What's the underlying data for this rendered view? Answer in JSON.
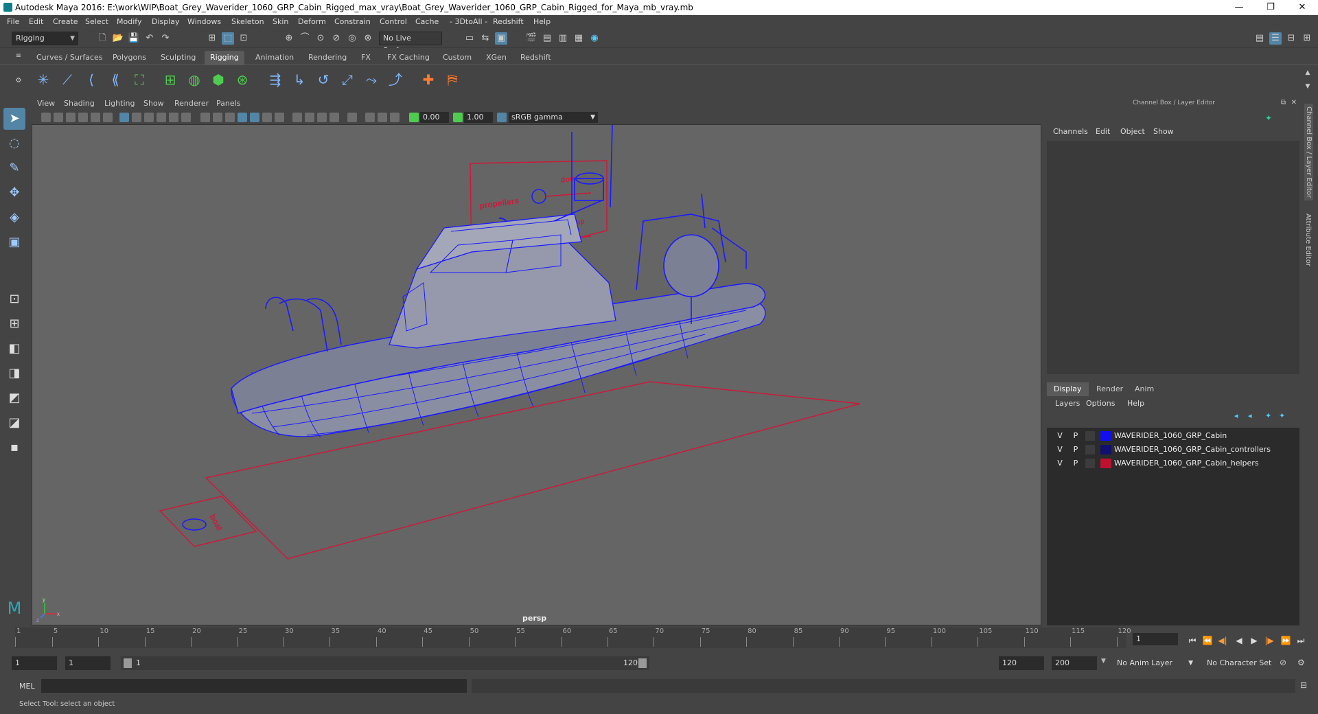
{
  "window": {
    "title": "Autodesk Maya 2016: E:\\work\\WIP\\Boat_Grey_Waverider_1060_GRP_Cabin_Rigged_max_vray\\Boat_Grey_Waverider_1060_GRP_Cabin_Rigged_for_Maya_mb_vray.mb",
    "minimize": "—",
    "restore": "❐",
    "close": "✕"
  },
  "menubar": [
    "File",
    "Edit",
    "Create",
    "Select",
    "Modify",
    "Display",
    "Windows",
    "Skeleton",
    "Skin",
    "Deform",
    "Constrain",
    "Control",
    "Cache",
    "- 3DtoAll -",
    "Redshift",
    "Help"
  ],
  "statusline": {
    "menuset": "Rigging",
    "live_surface": "No Live Surface"
  },
  "shelf_tabs": [
    "Curves / Surfaces",
    "Polygons",
    "Sculpting",
    "Rigging",
    "Animation",
    "Rendering",
    "FX",
    "FX Caching",
    "Custom",
    "XGen",
    "Redshift"
  ],
  "shelf_active": "Rigging",
  "panel_menu": [
    "View",
    "Shading",
    "Lighting",
    "Show",
    "Renderer",
    "Panels"
  ],
  "viewport_toolbar": {
    "exposure": "0.00",
    "gamma": "1.00",
    "color_space": "sRGB gamma"
  },
  "viewport": {
    "camera": "persp",
    "labels": {
      "propellers": "propellers",
      "door": "door",
      "engine_up": "engine up",
      "hull_label": "boat",
      "axis_y": "y",
      "axis_x": "x",
      "axis_z": "z"
    },
    "colors": {
      "wire": "#1a1aff",
      "controller": "#cc1a3a",
      "background": "#656565"
    }
  },
  "channel_box": {
    "title": "Channel Box / Layer Editor",
    "menu": [
      "Channels",
      "Edit",
      "Object",
      "Show"
    ]
  },
  "layer_editor": {
    "tabs": [
      "Display",
      "Render",
      "Anim"
    ],
    "active_tab": "Display",
    "menu": [
      "Layers",
      "Options",
      "Help"
    ],
    "layers": [
      {
        "v": "V",
        "p": "P",
        "name": "WAVERIDER_1060_GRP_Cabin",
        "color": "#1010ee"
      },
      {
        "v": "V",
        "p": "P",
        "name": "WAVERIDER_1060_GRP_Cabin_controllers",
        "color": "#101070"
      },
      {
        "v": "V",
        "p": "P",
        "name": "WAVERIDER_1060_GRP_Cabin_helpers",
        "color": "#c01030"
      }
    ]
  },
  "side_tabs": [
    "Channel Box / Layer Editor",
    "Attribute Editor"
  ],
  "time_slider": {
    "ticks": [
      1,
      5,
      10,
      15,
      20,
      25,
      30,
      35,
      40,
      45,
      50,
      55,
      60,
      65,
      70,
      75,
      80,
      85,
      90,
      95,
      100,
      105,
      110,
      115,
      120
    ],
    "current_frame": "1"
  },
  "range_slider": {
    "start": "1",
    "playback_start": "1",
    "range_start": "1",
    "range_end": "120",
    "playback_end": "120",
    "end": "200",
    "anim_layer": "No Anim Layer",
    "character_set": "No Character Set"
  },
  "command_line": {
    "label": "MEL"
  },
  "help_line": {
    "text": "Select Tool: select an object"
  }
}
